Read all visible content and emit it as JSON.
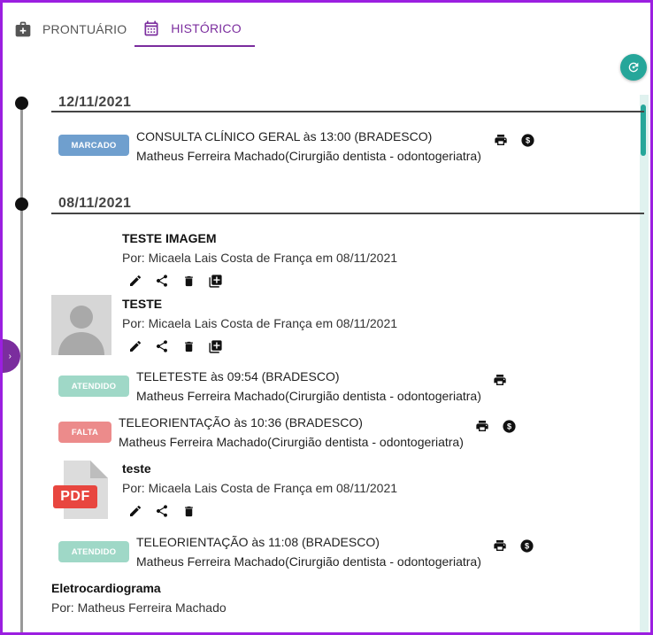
{
  "tabs": [
    {
      "label": "PRONTUÁRIO",
      "icon": "medical-bag-icon"
    },
    {
      "label": "HISTÓRICO",
      "icon": "calendar-icon",
      "active": true
    }
  ],
  "colors": {
    "accent": "#7b2d9e",
    "frame": "#9b1fe0",
    "teal": "#26a69a",
    "marcado": "#6f9fce",
    "atendido": "#9fd8c7",
    "falta": "#ec8b8b"
  },
  "groups": [
    {
      "date": "12/11/2021",
      "items": [
        {
          "badge": "MARCADO",
          "line1": "CONSULTA CLÍNICO GERAL às 13:00 (BRADESCO)",
          "line2": "Matheus Ferreira Machado(Cirurgião dentista - odontogeriatra)",
          "actions": [
            "print-icon",
            "dollar-icon"
          ]
        }
      ]
    },
    {
      "date": "08/11/2021",
      "items": [
        {
          "title": "TESTE IMAGEM",
          "author": "Por: Micaela Lais Costa de França em 08/11/2021",
          "actions": [
            "edit-icon",
            "share-icon",
            "delete-icon",
            "add-box-icon"
          ]
        },
        {
          "title": "TESTE",
          "author": "Por: Micaela Lais Costa de França em 08/11/2021",
          "actions": [
            "edit-icon",
            "share-icon",
            "delete-icon",
            "add-box-icon"
          ]
        },
        {
          "badge": "ATENDIDO",
          "line1": "TELETESTE às 09:54 (BRADESCO)",
          "line2": "Matheus Ferreira Machado(Cirurgião dentista - odontogeriatra)",
          "actions": [
            "print-icon"
          ]
        },
        {
          "badge": "FALTA",
          "line1": "TELEORIENTAÇÃO às 10:36 (BRADESCO)",
          "line2": "Matheus Ferreira Machado(Cirurgião dentista - odontogeriatra)",
          "actions": [
            "print-icon",
            "dollar-icon"
          ]
        },
        {
          "title": "teste",
          "pdf_label": "PDF",
          "author": "Por: Micaela Lais Costa de França em 08/11/2021",
          "actions": [
            "edit-icon",
            "share-icon",
            "delete-icon"
          ]
        },
        {
          "badge": "ATENDIDO",
          "line1": "TELEORIENTAÇÃO às 11:08 (BRADESCO)",
          "line2": "Matheus Ferreira Machado(Cirurgião dentista - odontogeriatra)",
          "actions": [
            "print-icon",
            "dollar-icon"
          ]
        },
        {
          "title": "Eletrocardiograma",
          "author": "Por: Matheus Ferreira Machado"
        }
      ]
    }
  ]
}
